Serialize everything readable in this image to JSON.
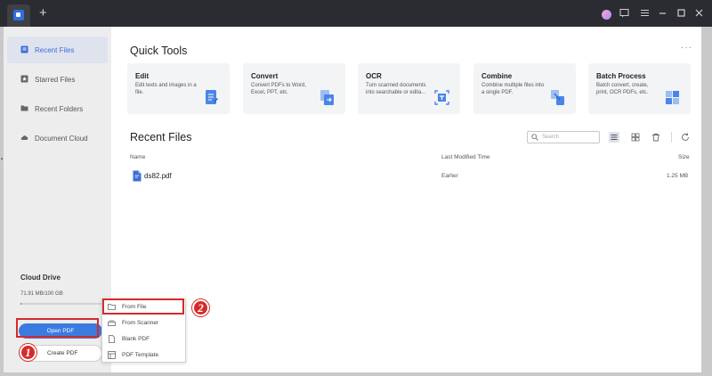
{
  "titlebar": {
    "new_tab_label": "+"
  },
  "sidebar": {
    "items": [
      {
        "label": "Recent Files",
        "icon": "recent-files-icon",
        "active": true
      },
      {
        "label": "Starred Files",
        "icon": "star-icon",
        "active": false
      },
      {
        "label": "Recent Folders",
        "icon": "folder-icon",
        "active": false
      },
      {
        "label": "Document Cloud",
        "icon": "cloud-icon",
        "active": false
      }
    ],
    "cloud": {
      "title": "Cloud Drive",
      "usage": "71.91 MB/100 GB",
      "usage_fraction": 0.0007
    },
    "open_pdf_label": "Open PDF",
    "create_pdf_label": "Create PDF"
  },
  "quick_tools": {
    "title": "Quick Tools",
    "more_label": "···",
    "cards": [
      {
        "title": "Edit",
        "desc": "Edit texts and images in a file.",
        "icon": "edit-icon"
      },
      {
        "title": "Convert",
        "desc": "Convert PDFs to Word, Excel, PPT, etc.",
        "icon": "convert-icon"
      },
      {
        "title": "OCR",
        "desc": "Turn scanned documents into searchable or edita...",
        "icon": "ocr-icon"
      },
      {
        "title": "Combine",
        "desc": "Combine multiple files into a single PDF.",
        "icon": "combine-icon"
      },
      {
        "title": "Batch Process",
        "desc": "Batch convert, create, print, OCR PDFs, etc.",
        "icon": "batch-icon"
      }
    ]
  },
  "recent_files": {
    "title": "Recent Files",
    "search_placeholder": "Search",
    "columns": {
      "name": "Name",
      "modified": "Last Modified Time",
      "size": "Size"
    },
    "rows": [
      {
        "name": "ds82.pdf",
        "modified": "Earlier",
        "size": "1.25 MB"
      }
    ]
  },
  "create_menu": {
    "items": [
      {
        "label": "From File",
        "icon": "folder-icon"
      },
      {
        "label": "From Scanner",
        "icon": "scanner-icon"
      },
      {
        "label": "Blank PDF",
        "icon": "blank-page-icon"
      },
      {
        "label": "PDF Template",
        "icon": "template-icon"
      }
    ]
  },
  "callouts": [
    "1",
    "2"
  ],
  "colors": {
    "accent": "#3a7be0",
    "highlight": "#d62a2a",
    "titlebar": "#2b2c31"
  }
}
